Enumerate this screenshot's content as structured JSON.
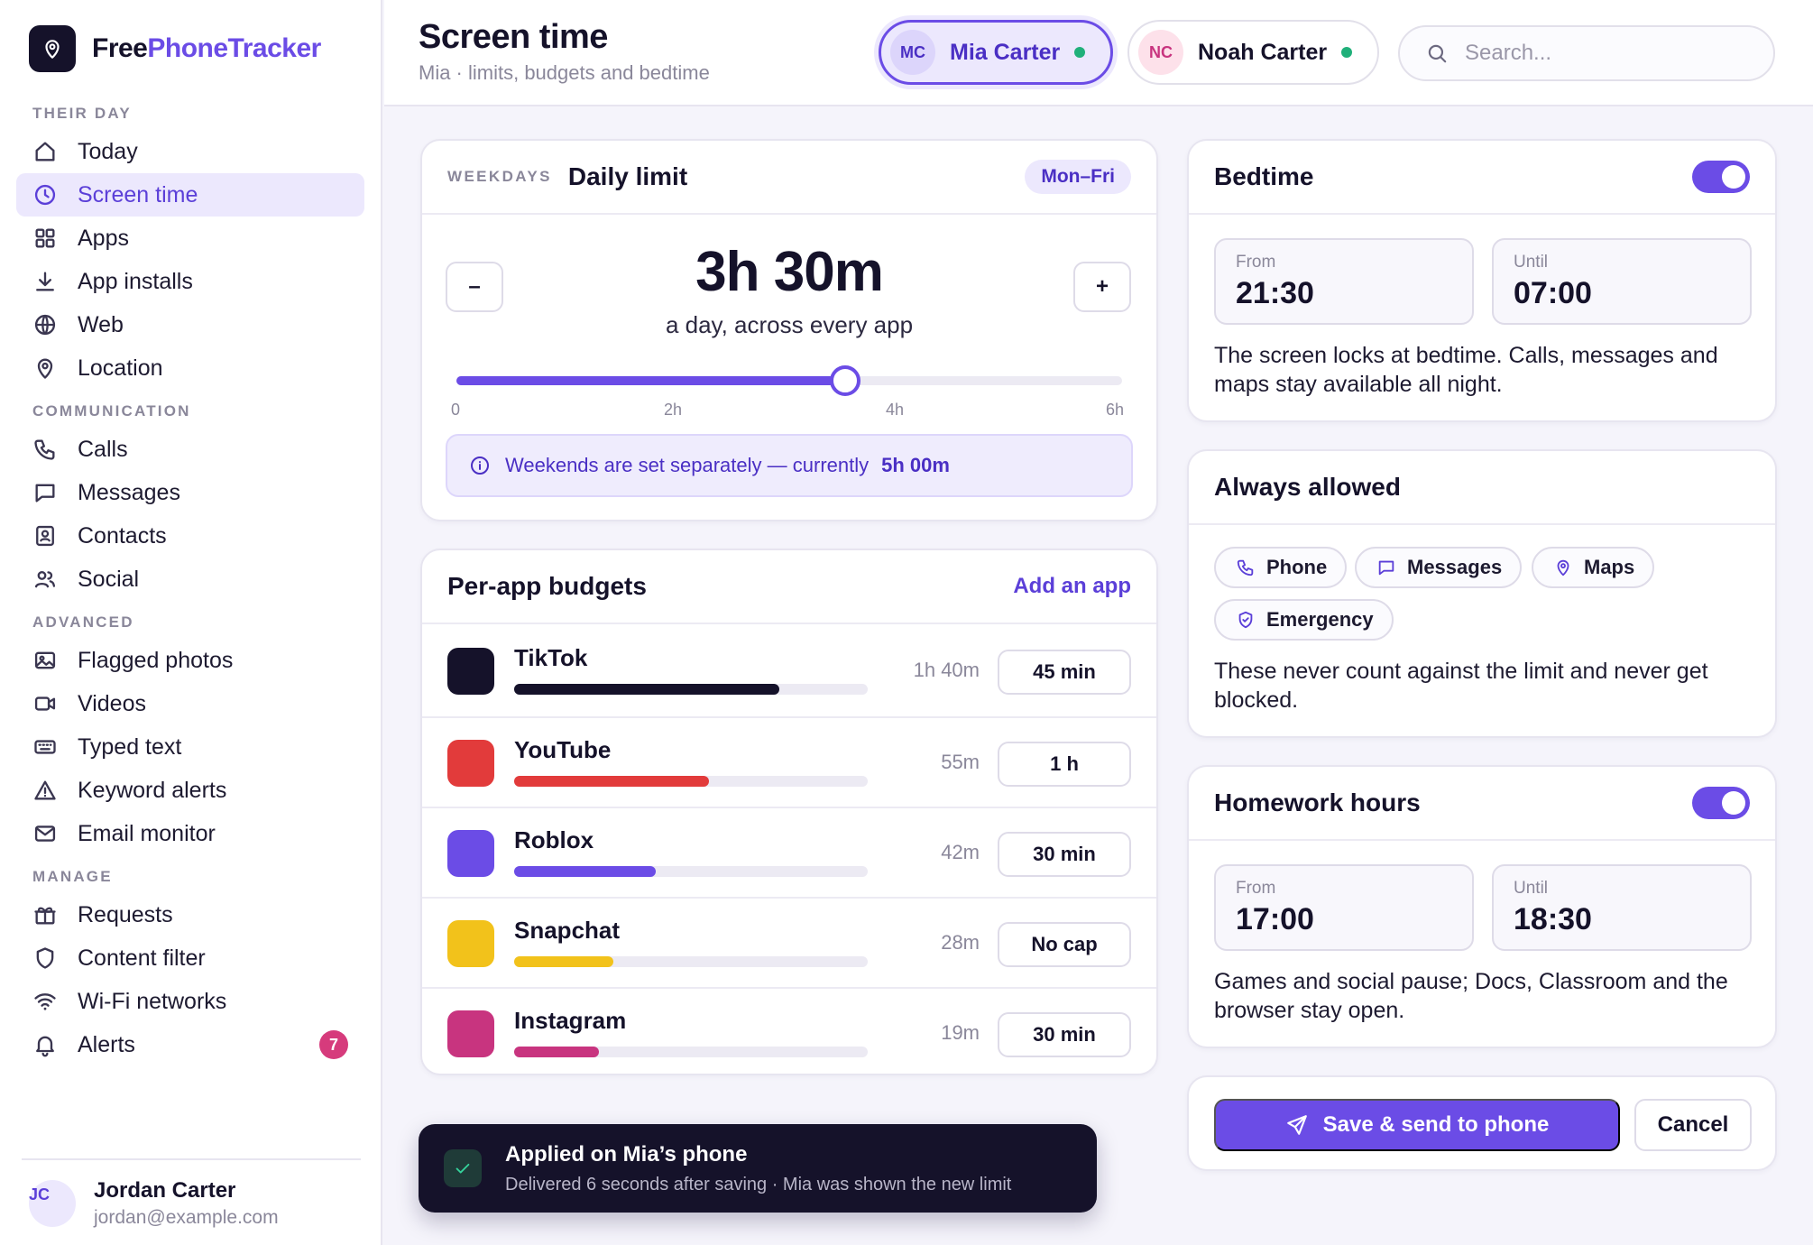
{
  "brand": {
    "part1": "Free",
    "part2": "PhoneTracker"
  },
  "nav": {
    "sections": [
      {
        "label": "THEIR DAY",
        "items": [
          {
            "label": "Today",
            "icon": "home-icon"
          },
          {
            "label": "Screen time",
            "icon": "clock-icon",
            "active": true
          },
          {
            "label": "Apps",
            "icon": "apps-grid-icon"
          },
          {
            "label": "App installs",
            "icon": "download-icon"
          },
          {
            "label": "Web",
            "icon": "globe-icon"
          },
          {
            "label": "Location",
            "icon": "map-pin-icon"
          }
        ]
      },
      {
        "label": "COMMUNICATION",
        "items": [
          {
            "label": "Calls",
            "icon": "phone-icon"
          },
          {
            "label": "Messages",
            "icon": "message-icon"
          },
          {
            "label": "Contacts",
            "icon": "contact-card-icon"
          },
          {
            "label": "Social",
            "icon": "users-icon"
          }
        ]
      },
      {
        "label": "ADVANCED",
        "items": [
          {
            "label": "Flagged photos",
            "icon": "image-icon"
          },
          {
            "label": "Videos",
            "icon": "video-icon"
          },
          {
            "label": "Typed text",
            "icon": "keyboard-icon"
          },
          {
            "label": "Keyword alerts",
            "icon": "warning-icon"
          },
          {
            "label": "Email monitor",
            "icon": "mail-icon"
          }
        ]
      },
      {
        "label": "MANAGE",
        "items": [
          {
            "label": "Requests",
            "icon": "gift-icon"
          },
          {
            "label": "Content filter",
            "icon": "shield-icon"
          },
          {
            "label": "Wi-Fi networks",
            "icon": "wifi-icon"
          },
          {
            "label": "Alerts",
            "icon": "bell-icon",
            "badge": "7"
          }
        ]
      }
    ]
  },
  "user": {
    "initials": "JC",
    "name": "Jordan Carter",
    "email": "jordan@example.com"
  },
  "header": {
    "title": "Screen time",
    "subtitle": "Mia · limits, budgets and bedtime",
    "children": [
      {
        "initials": "MC",
        "name": "Mia Carter",
        "active": true,
        "status_color": "#20b07a"
      },
      {
        "initials": "NC",
        "name": "Noah Carter",
        "active": false,
        "status_color": "#20b07a"
      }
    ],
    "search_placeholder": "Search..."
  },
  "daily_limit": {
    "eyebrow": "WEEKDAYS",
    "title": "Daily limit",
    "chip": "Mon–Fri",
    "decrement_label": "–",
    "increment_label": "+",
    "value": "3h 30m",
    "caption": "a day, across every app",
    "slider": {
      "min_hours": 0,
      "max_hours": 6,
      "value_hours": 3.5,
      "ticks": [
        "0",
        "2h",
        "4h",
        "6h"
      ]
    },
    "weekend_note": "Weekends are set separately — currently",
    "weekend_value": "5h 00m"
  },
  "budgets": {
    "title": "Per-app budgets",
    "add_link": "Add an app",
    "apps": [
      {
        "name": "TikTok",
        "color": "#15122a",
        "used": "1h 40m",
        "usage_fraction": 0.75,
        "cap": "45 min"
      },
      {
        "name": "YouTube",
        "color": "#e23b3b",
        "used": "55m",
        "usage_fraction": 0.55,
        "cap": "1 h"
      },
      {
        "name": "Roblox",
        "color": "#6b4ce6",
        "used": "42m",
        "usage_fraction": 0.4,
        "cap": "30 min"
      },
      {
        "name": "Snapchat",
        "color": "#f2c21b",
        "used": "28m",
        "usage_fraction": 0.28,
        "cap": "No cap"
      },
      {
        "name": "Instagram",
        "color": "#c8347f",
        "used": "19m",
        "usage_fraction": 0.24,
        "cap": "30 min"
      }
    ]
  },
  "toast": {
    "title": "Applied on Mia’s phone",
    "subtitle": "Delivered 6 seconds after saving · Mia was shown the new limit"
  },
  "bedtime": {
    "title": "Bedtime",
    "enabled": true,
    "from_label": "From",
    "from": "21:30",
    "until_label": "Until",
    "until": "07:00",
    "description": "The screen locks at bedtime. Calls, messages and maps stay available all night."
  },
  "always_allowed": {
    "title": "Always allowed",
    "apps": [
      {
        "label": "Phone",
        "icon": "phone-icon"
      },
      {
        "label": "Messages",
        "icon": "message-icon"
      },
      {
        "label": "Maps",
        "icon": "map-pin-icon"
      },
      {
        "label": "Emergency",
        "icon": "shield-check-icon"
      }
    ],
    "description": "These never count against the limit and never get blocked."
  },
  "homework": {
    "title": "Homework hours",
    "enabled": true,
    "from_label": "From",
    "from": "17:00",
    "until_label": "Until",
    "until": "18:30",
    "description": "Games and social pause; Docs, Classroom and the browser stay open."
  },
  "actions": {
    "save": "Save & send to phone",
    "cancel": "Cancel"
  },
  "colors": {
    "accent": "#6b4ce6",
    "accent_soft": "#ece8fd",
    "ink": "#15122a",
    "online": "#20b07a",
    "badge": "#d63b7c"
  }
}
